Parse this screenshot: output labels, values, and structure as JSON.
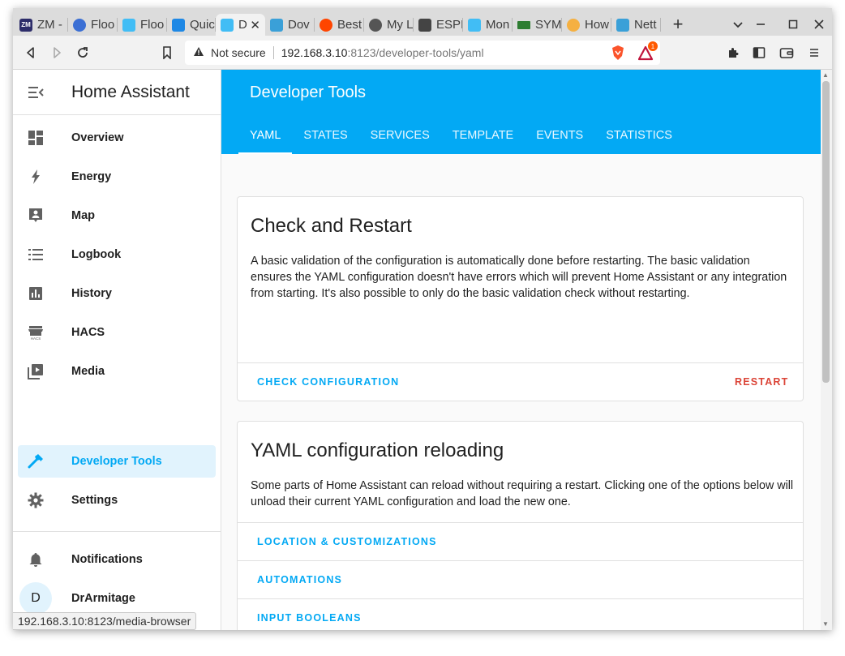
{
  "browser": {
    "tabs": [
      {
        "label": "ZM -",
        "fav_color": "#2d2d6a",
        "fav_text": "ZM"
      },
      {
        "label": "Floo",
        "fav_color": "#3b6fd4",
        "fav_text": ""
      },
      {
        "label": "Floo",
        "fav_color": "#41bdf5",
        "fav_text": ""
      },
      {
        "label": "Quic",
        "fav_color": "#1e88e5",
        "fav_text": ""
      },
      {
        "label": "D",
        "fav_color": "#41bdf5",
        "fav_text": ""
      },
      {
        "label": "Dov",
        "fav_color": "#3aa0d8",
        "fav_text": ""
      },
      {
        "label": "Best",
        "fav_color": "#ff4500",
        "fav_text": ""
      },
      {
        "label": "My L",
        "fav_color": "#555555",
        "fav_text": ""
      },
      {
        "label": "ESPI",
        "fav_color": "#444444",
        "fav_text": ""
      },
      {
        "label": "Mon",
        "fav_color": "#41bdf5",
        "fav_text": ""
      },
      {
        "label": "SYM",
        "fav_color": "#2e7d32",
        "fav_text": ""
      },
      {
        "label": "How",
        "fav_color": "#f5b041",
        "fav_text": ""
      },
      {
        "label": "Nett",
        "fav_color": "#3aa0d8",
        "fav_text": ""
      }
    ],
    "new_tab": "+",
    "address": {
      "security": "Not secure",
      "host": "192.168.3.10",
      "path": ":8123/developer-tools/yaml"
    },
    "shield_badge": "1",
    "status_url": "192.168.3.10:8123/media-browser"
  },
  "sidebar": {
    "title": "Home Assistant",
    "items": [
      {
        "label": "Overview",
        "icon": "dashboard-icon"
      },
      {
        "label": "Energy",
        "icon": "lightning-icon"
      },
      {
        "label": "Map",
        "icon": "map-icon"
      },
      {
        "label": "Logbook",
        "icon": "list-icon"
      },
      {
        "label": "History",
        "icon": "chart-icon"
      },
      {
        "label": "HACS",
        "icon": "hacs-icon"
      },
      {
        "label": "Media",
        "icon": "play-icon"
      },
      {
        "label": "Developer Tools",
        "icon": "hammer-icon"
      },
      {
        "label": "Settings",
        "icon": "gear-icon"
      },
      {
        "label": "Notifications",
        "icon": "bell-icon"
      },
      {
        "label": "DrArmitage",
        "icon": "avatar"
      }
    ],
    "avatar_initial": "D"
  },
  "header": {
    "title": "Developer Tools",
    "tabs": [
      "YAML",
      "STATES",
      "SERVICES",
      "TEMPLATE",
      "EVENTS",
      "STATISTICS"
    ]
  },
  "check_card": {
    "title": "Check and Restart",
    "body": "A basic validation of the configuration is automatically done before restarting. The basic validation ensures the YAML configuration doesn't have errors which will prevent Home Assistant or any integration from starting. It's also possible to only do the basic validation check without restarting.",
    "check_label": "CHECK CONFIGURATION",
    "restart_label": "RESTART"
  },
  "reload_card": {
    "title": "YAML configuration reloading",
    "body": "Some parts of Home Assistant can reload without requiring a restart. Clicking one of the options below will unload their current YAML configuration and load the new one.",
    "items": [
      "LOCATION & CUSTOMIZATIONS",
      "AUTOMATIONS",
      "INPUT BOOLEANS"
    ]
  },
  "colors": {
    "primary": "#03a9f4",
    "error": "#db4437"
  }
}
